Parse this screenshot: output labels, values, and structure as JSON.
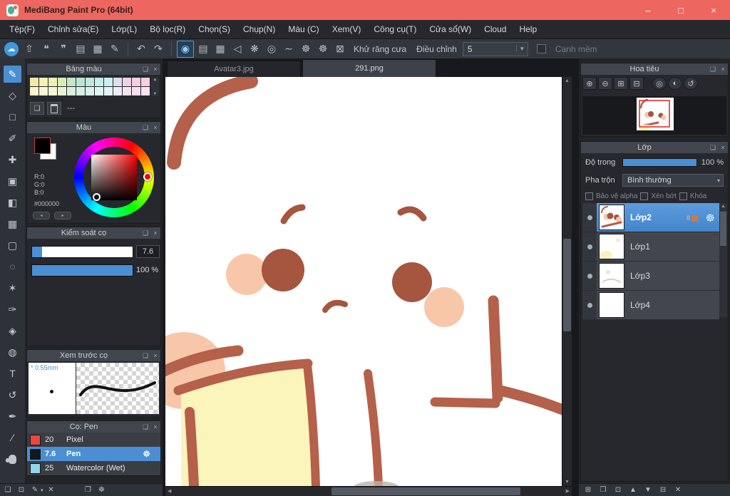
{
  "window": {
    "title": "MediBang Paint Pro (64bit)",
    "minimize": "–",
    "maximize": "□",
    "close": "×"
  },
  "menubar": {
    "items": [
      "Tệp(F)",
      "Chỉnh sửa(E)",
      "Lớp(L)",
      "Bộ lọc(R)",
      "Chọn(S)",
      "Chụp(N)",
      "Màu (C)",
      "Xem(V)",
      "Công cụ(T)",
      "Cửa sổ(W)",
      "Cloud",
      "Help"
    ]
  },
  "toolbar": {
    "file_icons": [
      {
        "name": "cloud-save-icon",
        "glyph": "☁"
      },
      {
        "name": "share-icon",
        "glyph": "⇧"
      },
      {
        "name": "comment-icon",
        "glyph": "❝"
      },
      {
        "name": "chat-icon",
        "glyph": "❞"
      },
      {
        "name": "new-document-icon",
        "glyph": "▤"
      },
      {
        "name": "grid-document-icon",
        "glyph": "▦"
      },
      {
        "name": "edit-document-icon",
        "glyph": "✎"
      }
    ],
    "undo_glyph": "↶",
    "redo_glyph": "↷",
    "brush_icons": [
      {
        "name": "brush-tip-circle-icon",
        "glyph": "◉"
      },
      {
        "name": "brush-lines-icon",
        "glyph": "▤"
      },
      {
        "name": "brush-grid-icon",
        "glyph": "▦"
      },
      {
        "name": "brush-triangle-icon",
        "glyph": "◁"
      },
      {
        "name": "brush-scatter-icon",
        "glyph": "❋"
      },
      {
        "name": "brush-rings-icon",
        "glyph": "◎"
      },
      {
        "name": "brush-curve-icon",
        "glyph": "∼"
      },
      {
        "name": "brush-config-icon",
        "glyph": "☸"
      },
      {
        "name": "settings-gear-icon",
        "glyph": "☸"
      }
    ],
    "antialias_glyph": "⊠",
    "antialias_label": "Khử răng cưa",
    "adjust_label": "Điều chỉnh",
    "adjust_value": "5",
    "soft_edge_label": "Cạnh mềm"
  },
  "tools": [
    {
      "name": "brush",
      "glyph": "✎"
    },
    {
      "name": "eraser",
      "glyph": "◇"
    },
    {
      "name": "rectangle",
      "glyph": "□"
    },
    {
      "name": "dot-pen",
      "glyph": "✐"
    },
    {
      "name": "move",
      "glyph": "✚"
    },
    {
      "name": "fill-rect",
      "glyph": "▣"
    },
    {
      "name": "bucket",
      "glyph": "◧"
    },
    {
      "name": "gradient",
      "glyph": "▦"
    },
    {
      "name": "select-rect",
      "glyph": "▢"
    },
    {
      "name": "select-lasso",
      "glyph": "◌"
    },
    {
      "name": "magic-wand",
      "glyph": "✶"
    },
    {
      "name": "select-pen",
      "glyph": "✑"
    },
    {
      "name": "select-eraser",
      "glyph": "◈"
    },
    {
      "name": "select-bucket",
      "glyph": "◍"
    },
    {
      "name": "text",
      "glyph": "T"
    },
    {
      "name": "operation",
      "glyph": "↺"
    },
    {
      "name": "pen",
      "glyph": "✒"
    },
    {
      "name": "eyedropper",
      "glyph": "∕"
    },
    {
      "name": "hand",
      "glyph": ""
    }
  ],
  "tabs": {
    "items": [
      {
        "label": "Avatar3.jpg",
        "active": false
      },
      {
        "label": "291.png",
        "active": true
      }
    ]
  },
  "panels": {
    "palette": {
      "title": "Bảng màu",
      "empty_label": "---",
      "colors": [
        "#f5e9a8",
        "#faf0b4",
        "#eef2b0",
        "#d8edb6",
        "#c4e8c2",
        "#bce6d2",
        "#bfe9df",
        "#c6edea",
        "#cdeff2",
        "#dfdef0",
        "#eed2e8",
        "#f5cde2",
        "#f8d0de",
        "#faf3cc",
        "#fcf6d4",
        "#f5f7d2",
        "#e8f4d6",
        "#daf0dc",
        "#d6f0e6",
        "#d8f2ec",
        "#def4f2",
        "#e2f5f6",
        "#eeeaf6",
        "#f5e4f0",
        "#f8e0ec",
        "#fae4ee"
      ]
    },
    "color": {
      "title": "Màu",
      "r": "R:0",
      "g": "G:0",
      "b": "B:0",
      "hex": "#000000"
    },
    "brush_control": {
      "title": "Kiểm soát cọ",
      "size_value": "7.6",
      "opacity_value": "100 %"
    },
    "brush_preview": {
      "title": "Xem trước cọ",
      "pressure_mark": "*",
      "size_label": "0.55mm"
    },
    "brush_list": {
      "title": "Cọ: Pen",
      "items": [
        {
          "size": "20",
          "name": "Pixel",
          "color": "#e8483d",
          "selected": false
        },
        {
          "size": "7.6",
          "name": "Pen",
          "color": "#14171c",
          "selected": true
        },
        {
          "size": "25",
          "name": "Watercolor (Wet)",
          "color": "#8ed7ea",
          "selected": false
        }
      ]
    },
    "navigator": {
      "title": "Hoa tiêu",
      "zoom_icons": [
        {
          "name": "zoom-in-icon",
          "glyph": "⊕"
        },
        {
          "name": "zoom-out-icon",
          "glyph": "⊖"
        },
        {
          "name": "fit-window-icon",
          "glyph": "⊞"
        },
        {
          "name": "actual-size-icon",
          "glyph": "⊟"
        },
        {
          "name": "rotate-reset-icon",
          "glyph": "◎"
        },
        {
          "name": "flip-horizontal-icon",
          "glyph": "◐"
        },
        {
          "name": "rotate-view-icon",
          "glyph": "↺"
        }
      ]
    },
    "layers": {
      "title": "Lớp",
      "opacity_label": "Độ trong",
      "opacity_value": "100 %",
      "blend_label": "Pha trộn",
      "blend_value": "Bình thường",
      "protect_alpha_label": "Bảo vệ alpha",
      "clip_label": "Xén bớt",
      "lock_label": "Khóa",
      "bit_badge": "8",
      "items": [
        {
          "name": "Lớp2",
          "selected": true
        },
        {
          "name": "Lớp1",
          "selected": false
        },
        {
          "name": "Lớp3",
          "selected": false
        },
        {
          "name": "Lớp4",
          "selected": false
        }
      ]
    }
  },
  "bottom_left_icons": [
    {
      "name": "new-brush-icon",
      "glyph": "❏"
    },
    {
      "name": "clipboard-brush-icon",
      "glyph": "⊡"
    },
    {
      "name": "brush-menu-icon",
      "glyph": "✎"
    },
    {
      "name": "delete-brush-icon",
      "glyph": "✕"
    },
    {
      "name": "folder-icon",
      "glyph": "❐"
    },
    {
      "name": "brush-settings-icon",
      "glyph": "☸"
    }
  ],
  "bottom_right_icons": [
    {
      "name": "add-layer-icon",
      "glyph": "⊞"
    },
    {
      "name": "add-folder-icon",
      "glyph": "❐"
    },
    {
      "name": "duplicate-layer-icon",
      "glyph": "⊡"
    },
    {
      "name": "move-layer-up-icon",
      "glyph": "▲"
    },
    {
      "name": "move-layer-down-icon",
      "glyph": "▼"
    },
    {
      "name": "merge-layer-icon",
      "glyph": "⊟"
    },
    {
      "name": "delete-layer-icon",
      "glyph": "✕"
    }
  ],
  "ui": {
    "popout": "❏",
    "close": "×",
    "caret": "▾",
    "up": "▲",
    "down": "▼",
    "left": "◀",
    "right": "▶",
    "gear": "☸",
    "tri_left": "◂",
    "tri_right": "▸"
  },
  "colors": {
    "titlebar": "#ed665f",
    "accent": "#4a8fd4",
    "selection_blue": "#4a8fd4",
    "outline_brown": "#b5604a",
    "eye_brown": "#a6553f",
    "blush_peach": "#f8c7aa",
    "book_yellow": "#fcf5bb",
    "navigator_frame_red": "#e03030"
  }
}
